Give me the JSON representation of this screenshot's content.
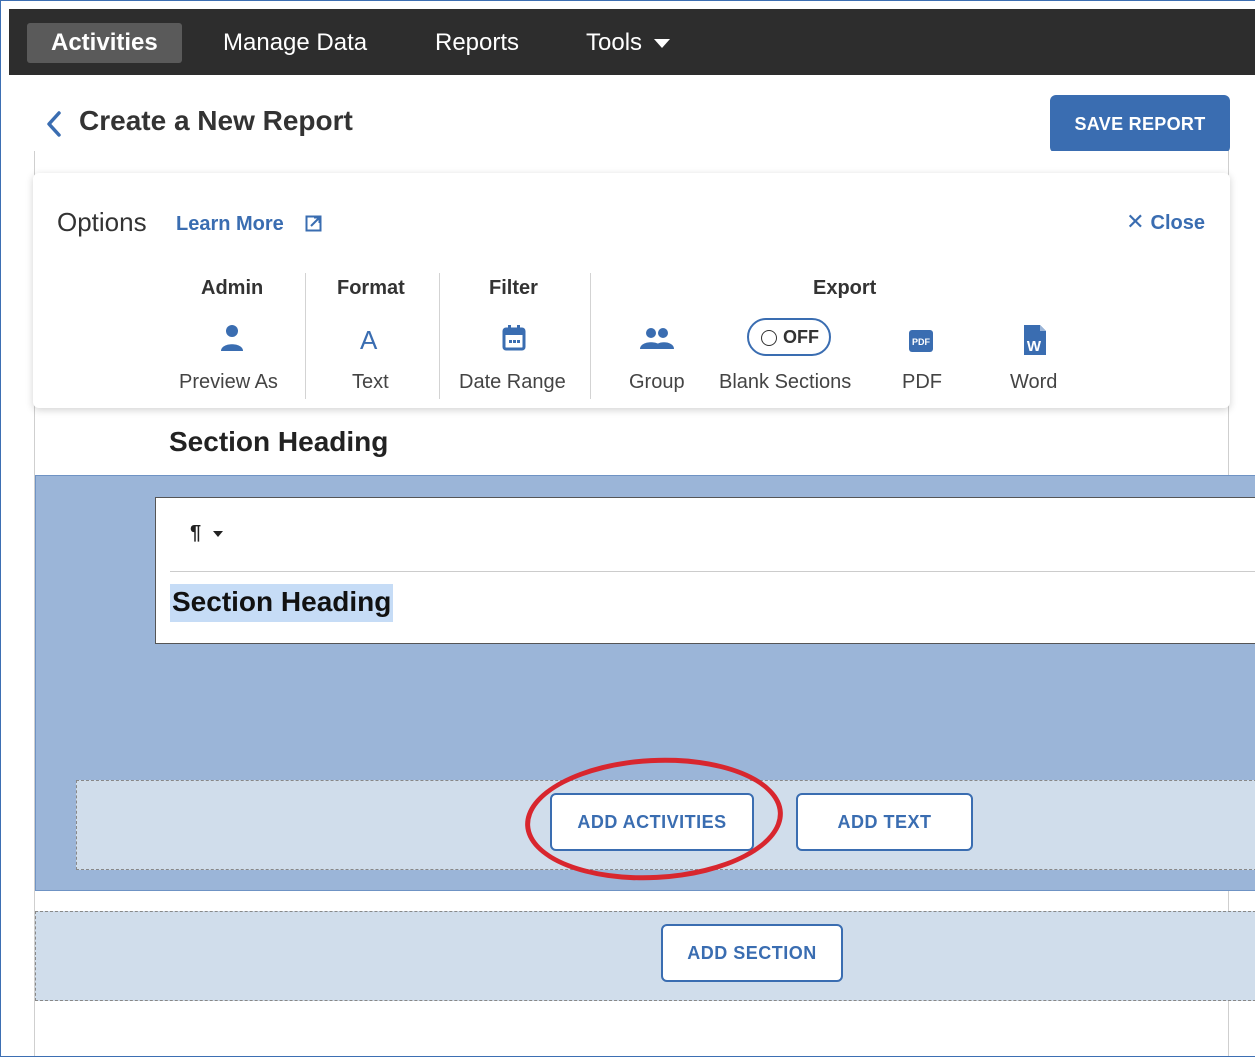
{
  "nav": {
    "items": [
      {
        "label": "Activities"
      },
      {
        "label": "Manage Data"
      },
      {
        "label": "Reports"
      },
      {
        "label": "Tools"
      }
    ]
  },
  "header": {
    "title": "Create a New Report",
    "save_label": "SAVE REPORT"
  },
  "options": {
    "title": "Options",
    "learn_more": "Learn More",
    "close_label": "Close",
    "groups": {
      "admin": "Admin",
      "format": "Format",
      "filter": "Filter",
      "export": "Export"
    },
    "items": {
      "preview_as": "Preview As",
      "text": "Text",
      "text_icon": "A",
      "date_range": "Date Range",
      "group": "Group",
      "blank_sections": "Blank Sections",
      "toggle_state": "OFF",
      "pdf": "PDF",
      "word": "Word"
    }
  },
  "section": {
    "heading_label": "Section Heading",
    "format_symbol": "¶",
    "editor_text": "Section Heading",
    "add_activities": "ADD ACTIVITIES",
    "add_text": "ADD TEXT",
    "add_section": "ADD SECTION"
  },
  "colors": {
    "nav_bg": "#2d2d2d",
    "accent": "#3a6db1",
    "section_bg": "#9bb5d8",
    "drop_zone_bg": "#d0ddeb",
    "annotation": "#d8262e"
  },
  "icons": [
    "chevron-left-icon",
    "external-link-icon",
    "close-icon",
    "user-icon",
    "calendar-icon",
    "group-icon",
    "pdf-icon",
    "word-icon",
    "caret-down-icon"
  ]
}
